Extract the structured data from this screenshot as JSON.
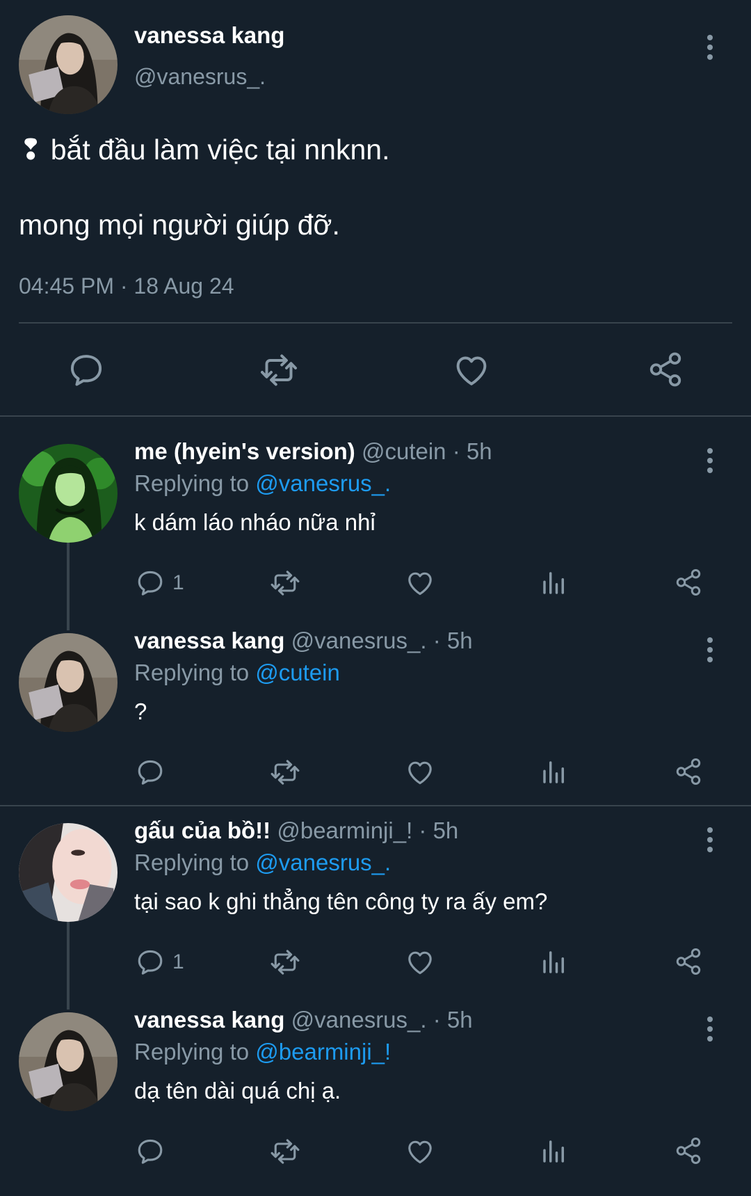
{
  "colors": {
    "background": "#15202b",
    "text_primary": "#ffffff",
    "text_secondary": "#8899a6",
    "mention": "#1d9bf0",
    "divider": "#38444d"
  },
  "main_tweet": {
    "name": "vanessa kang",
    "handle": "@vanesrus_.",
    "text_line1": "❢ bắt đầu làm việc tại nnknn.",
    "text_line2": "mong mọi người giúp đỡ.",
    "timestamp": "04:45 PM · 18 Aug 24",
    "actions": [
      "reply-icon",
      "retweet-icon",
      "like-icon",
      "share-icon"
    ],
    "more_icon": "more-vertical-icon"
  },
  "replies": [
    {
      "name": "me (hyein's version)",
      "meta": " @cutein · 5h",
      "replying_prefix": "Replying to ",
      "replying_to": "@vanesrus_.",
      "text": "k dám láo nháo nữa nhỉ",
      "reply_count": "1"
    },
    {
      "name": "vanessa kang",
      "meta": "  @vanesrus_. · 5h",
      "replying_prefix": "Replying to ",
      "replying_to": "@cutein",
      "text": "?",
      "reply_count": ""
    },
    {
      "name": "gấu của bồ!!",
      "meta": " @bearminji_! · 5h",
      "replying_prefix": "Replying to ",
      "replying_to": "@vanesrus_.",
      "text": "tại sao k ghi thẳng tên công ty ra ấy em?",
      "reply_count": "1"
    },
    {
      "name": "vanessa kang",
      "meta": "  @vanesrus_. · 5h",
      "replying_prefix": "Replying to ",
      "replying_to": "@bearminji_!",
      "text": "dạ tên dài quá chị ạ.",
      "reply_count": ""
    }
  ]
}
